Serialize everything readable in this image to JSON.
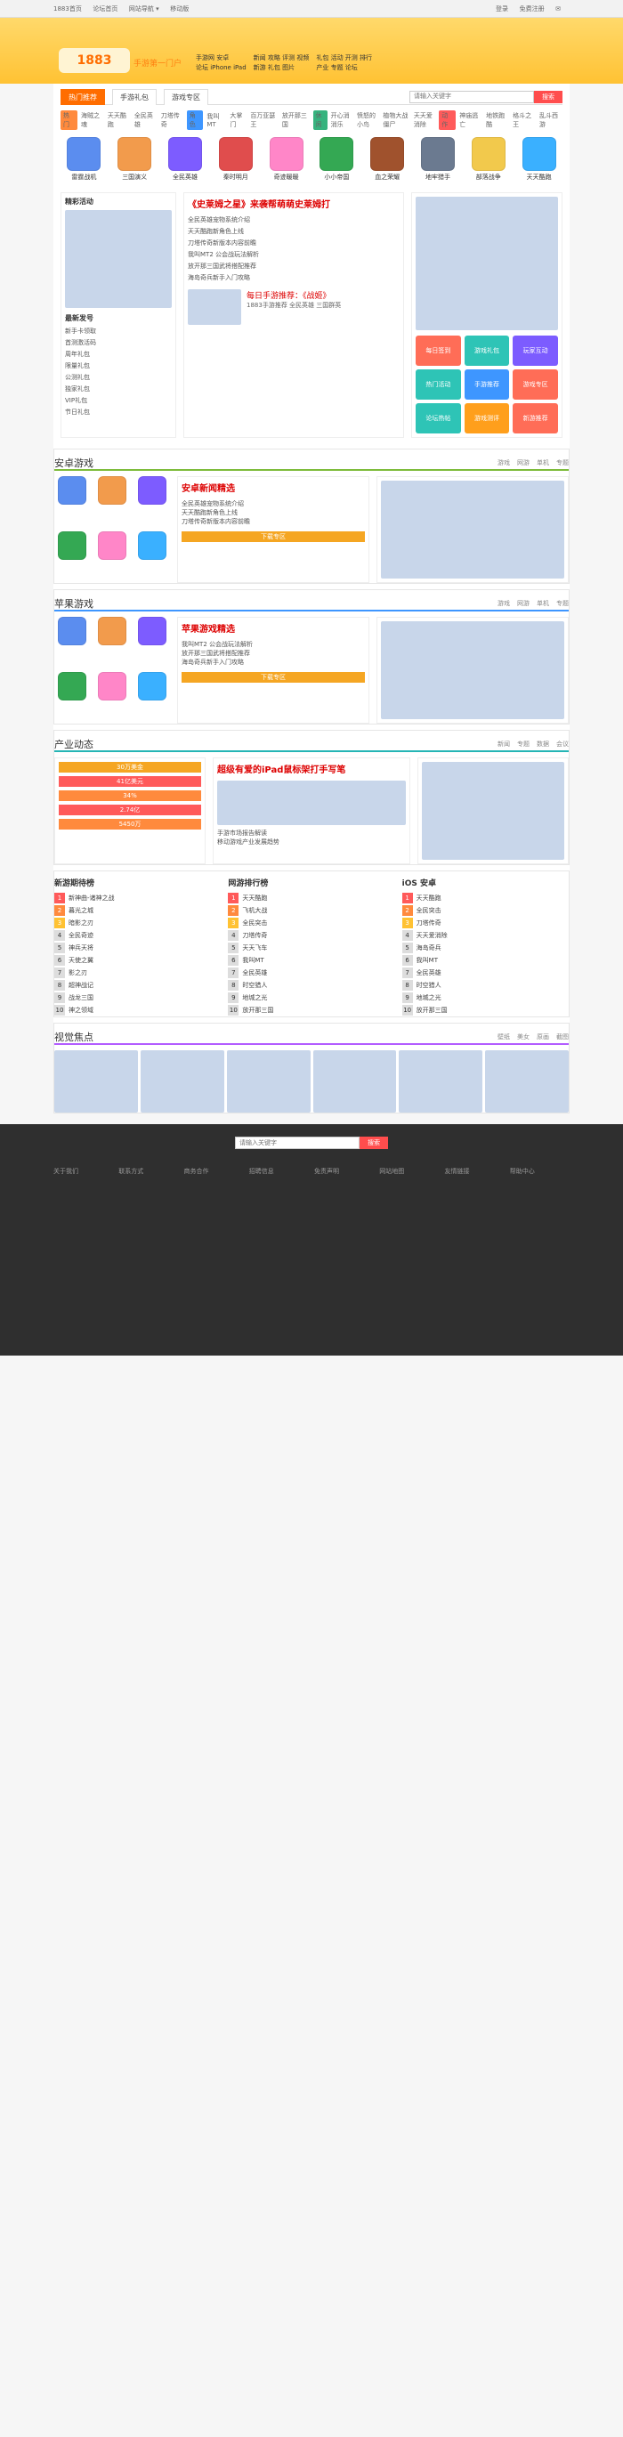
{
  "top": {
    "left": [
      "1883首页",
      "论坛首页",
      "网站导航 ▾",
      "移动版"
    ],
    "right": [
      "登录",
      "免费注册",
      "✉"
    ]
  },
  "brand": {
    "logo": "1883",
    "slogan": "手游第一门户"
  },
  "nav": {
    "cols": [
      [
        "手游网 安卓",
        "论坛 iPhone iPad"
      ],
      [
        "新闻 攻略 评测 视频",
        "新游 礼包 图片"
      ],
      [
        "礼包 活动 开测 排行",
        "产业 专题 论坛"
      ]
    ],
    "tabs": [
      "热门推荐",
      "手游礼包",
      "游戏专区"
    ],
    "search_placeholder": "请输入关键字",
    "search_button": "搜索"
  },
  "tags": [
    {
      "label": "热门",
      "color": "orange",
      "items": [
        "海贼之魂",
        "天天酷跑",
        "全民英雄",
        "刀塔传奇"
      ]
    },
    {
      "label": "角色",
      "color": "blue",
      "items": [
        "我叫MT",
        "大掌门",
        "百万亚瑟王",
        "放开那三国"
      ]
    },
    {
      "label": "休闲",
      "color": "green",
      "items": [
        "开心消消乐",
        "愤怒的小鸟",
        "植物大战僵尸",
        "天天爱消除"
      ]
    },
    {
      "label": "动作",
      "color": "red",
      "items": [
        "神庙逃亡",
        "地铁跑酷",
        "格斗之王",
        "乱斗西游"
      ]
    }
  ],
  "featured_games": [
    {
      "name": "雷霆战机",
      "icon": "game-icon",
      "color": "#5b8def"
    },
    {
      "name": "三国演义",
      "icon": "game-icon",
      "color": "#f29b4c"
    },
    {
      "name": "全民英雄",
      "icon": "game-icon",
      "color": "#7d5cff"
    },
    {
      "name": "秦时明月",
      "icon": "game-icon",
      "color": "#e04d4d"
    },
    {
      "name": "奇迹暖暖",
      "icon": "game-icon",
      "color": "#ff86c8"
    },
    {
      "name": "小小帝国",
      "icon": "game-icon",
      "color": "#34a853"
    },
    {
      "name": "血之荣耀",
      "icon": "game-icon",
      "color": "#a0522d"
    },
    {
      "name": "地牢猎手",
      "icon": "game-icon",
      "color": "#6b7a90"
    },
    {
      "name": "部落战争",
      "icon": "game-icon",
      "color": "#f2c94c"
    },
    {
      "name": "天天酷跑",
      "icon": "game-icon",
      "color": "#3ab0ff"
    }
  ],
  "left_panel": {
    "title": "精彩活动",
    "list_title": "最新发号",
    "list": [
      "新手卡领取",
      "首测激活码",
      "周年礼包",
      "限量礼包",
      "公测礼包",
      "独家礼包",
      "VIP礼包",
      "节日礼包"
    ]
  },
  "news": {
    "headline": "《史莱姆之星》来袭帮萌萌史莱姆打",
    "items": [
      "全民英雄宠物系统介绍",
      "天天酷跑新角色上线",
      "刀塔传奇新版本内容前瞻",
      "我叫MT2 公会战玩法解析",
      "放开那三国武将搭配推荐",
      "海岛奇兵新手入门攻略"
    ],
    "promo_title": "每日手游推荐：《战姬》",
    "promo_sub": "1883手游推荐 全民英雄 三国群英"
  },
  "right_squares": [
    {
      "label": "每日签到",
      "color": "#ff6d57"
    },
    {
      "label": "游戏礼包",
      "color": "#2ec4b6"
    },
    {
      "label": "玩家互动",
      "color": "#7c5cff"
    },
    {
      "label": "热门活动",
      "color": "#2ec4b6"
    },
    {
      "label": "手游推荐",
      "color": "#3e96ff"
    },
    {
      "label": "游戏专区",
      "color": "#ff6d57"
    },
    {
      "label": "论坛热帖",
      "color": "#2ec4b6"
    },
    {
      "label": "游戏测评",
      "color": "#ff9f1c"
    },
    {
      "label": "新游推荐",
      "color": "#ff6d57"
    }
  ],
  "sections": {
    "android": {
      "title": "安卓游戏",
      "links": [
        "游戏",
        "网游",
        "单机",
        "专题"
      ]
    },
    "ios": {
      "title": "苹果游戏",
      "links": [
        "游戏",
        "网游",
        "单机",
        "专题"
      ]
    },
    "industry": {
      "title": "产业动态",
      "links": [
        "新闻",
        "专题",
        "数据",
        "会议"
      ]
    },
    "ranks": [
      {
        "title": "新游期待榜",
        "items": [
          "新神曲-诸神之战",
          "暮光之城",
          "暗影之刃",
          "全民奇迹",
          "神兵天将",
          "天使之翼",
          "影之刃",
          "超神战记",
          "战龙三国",
          "神之领域"
        ]
      },
      {
        "title": "网游排行榜",
        "items": [
          "天天酷跑",
          "飞机大战",
          "全民突击",
          "刀塔传奇",
          "天天飞车",
          "我叫MT",
          "全民英雄",
          "时空猎人",
          "地城之光",
          "放开那三国"
        ]
      },
      {
        "title": "iOS 安卓",
        "items": [
          "天天酷跑",
          "全民突击",
          "刀塔传奇",
          "天天爱消除",
          "海岛奇兵",
          "我叫MT",
          "全民英雄",
          "时空猎人",
          "地城之光",
          "放开那三国"
        ]
      }
    ],
    "gallery": {
      "title": "视觉焦点",
      "links": [
        "壁纸",
        "美女",
        "原画",
        "截图"
      ]
    }
  },
  "footer": {
    "search_placeholder": "请输入关键字",
    "search_button": "搜索",
    "cols": [
      "关于我们",
      "联系方式",
      "商务合作",
      "招聘信息",
      "免责声明",
      "网站地图",
      "友情链接",
      "帮助中心"
    ]
  }
}
